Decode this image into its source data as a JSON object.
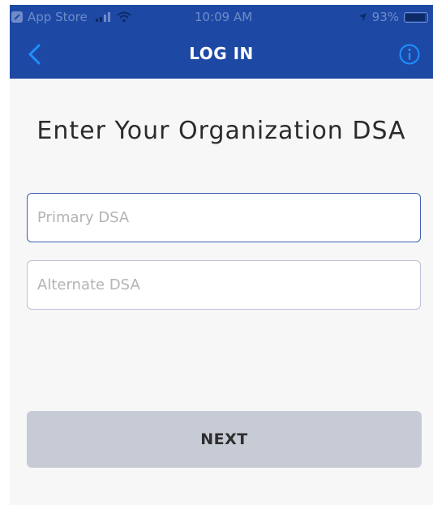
{
  "status_bar": {
    "back_app_label": "App Store",
    "time": "10:09 AM",
    "battery_percent": "93%",
    "battery_level": 0.93,
    "cellular_bars": 2
  },
  "nav": {
    "title": "LOG IN",
    "back_icon": "chevron-left-icon",
    "info_icon": "info-icon"
  },
  "main": {
    "heading": "Enter Your Organization DSA",
    "primary_field": {
      "placeholder": "Primary DSA",
      "value": ""
    },
    "alternate_field": {
      "placeholder": "Alternate DSA",
      "value": ""
    },
    "next_label": "NEXT"
  },
  "colors": {
    "header_bg": "#1d49a5",
    "screen_bg": "#f7f7f7",
    "accent": "#3e5fb3",
    "button_bg": "#c7cbd5"
  }
}
